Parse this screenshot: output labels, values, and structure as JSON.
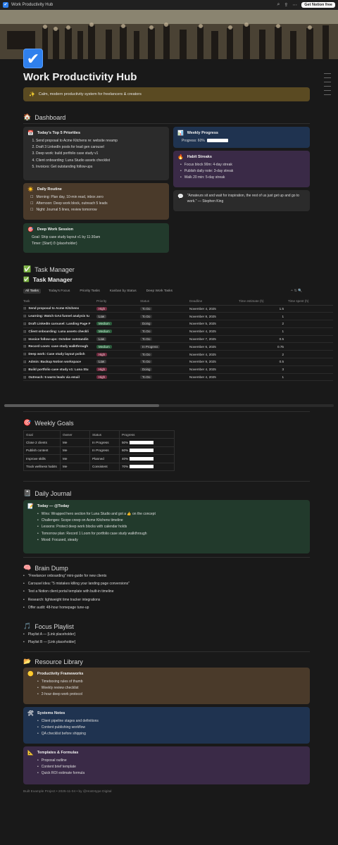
{
  "topbar": {
    "title": "Work Productivity Hub",
    "button": "Get Notion free",
    "icons": [
      "search-icon",
      "share-icon",
      "more-icon"
    ]
  },
  "page": {
    "icon": "✔",
    "title": "Work Productivity Hub",
    "banner": "Calm, modern productivity system for freelancers & creators",
    "banner_emoji": "✨"
  },
  "dashboard": {
    "heading": "Dashboard",
    "heading_emoji": "🏠",
    "priorities": {
      "title": "Today's Top 5 Priorities",
      "emoji": "📅",
      "items": [
        "Send proposal to Acme Kitchens re: website revamp",
        "Draft 3 LinkedIn posts for lead gen carousel",
        "Deep work: build portfolio case study v1",
        "Client onboarding: Luna Studio assets checklist",
        "Invoices: Get outstanding follow-ups"
      ]
    },
    "routine": {
      "title": "Daily Routine",
      "emoji": "☀️",
      "items": [
        "Morning: Plan day, 10-min read, inbox zero",
        "Afternoon: Deep work block, outreach 5 leads",
        "Night: Journal 5 lines, review tomorrow"
      ]
    },
    "deepwork": {
      "title": "Deep Work Session",
      "emoji": "🎯",
      "goal": "Goal: Ship case study layout v1 by 11:30am",
      "timer": "Timer: [Start] ⏱ (placeholder)"
    },
    "weekly": {
      "title": "Weekly Progress",
      "emoji": "📊",
      "label": "Progress: 60%",
      "value": 0.6
    },
    "streaks": {
      "title": "Habit Streaks",
      "emoji": "🔥",
      "items": [
        "Focus block 90m: 4-day streak",
        "Publish daily note: 3-day streak",
        "Walk 20 min: 5-day streak"
      ]
    },
    "quote": {
      "emoji": "💬",
      "text": "\"Amateurs sit and wait for inspiration, the rest of us just get up and go to work.\" — Stephen King"
    }
  },
  "tasks": {
    "heading": "Task Manager",
    "heading_emoji": "✅",
    "db_title": "Task Manager",
    "db_emoji": "✅",
    "tabs": [
      "All Tasks",
      "Today's Focus",
      "Priority Tasks",
      "Kanban by Status",
      "Deep Work Tasks"
    ],
    "columns": [
      "Task",
      "Priority",
      "Status",
      "Deadline",
      "Time estimate (h)",
      "Time spent (h)"
    ],
    "rows": [
      {
        "task": "Send proposal to Acme Kitchens",
        "priority": "High",
        "pclass": "p-high",
        "status": "To Do",
        "deadline": "November 4, 2025",
        "est": "1.5"
      },
      {
        "task": "Learning: Watch GA4 funnel analysis tu",
        "priority": "Low",
        "pclass": "p-low",
        "status": "To Do",
        "deadline": "November 8, 2025",
        "est": "1"
      },
      {
        "task": "Draft LinkedIn carousel: Landing Page F",
        "priority": "Medium",
        "pclass": "p-med",
        "status": "Doing",
        "deadline": "November 5, 2025",
        "est": "2"
      },
      {
        "task": "Client onboarding: Luna assets checkli",
        "priority": "Medium",
        "pclass": "p-med",
        "status": "To Do",
        "deadline": "November 4, 2025",
        "est": "1"
      },
      {
        "task": "Invoice follow-ups: October outstandin",
        "priority": "Low",
        "pclass": "p-low",
        "status": "To Do",
        "deadline": "November 7, 2025",
        "est": "0.5"
      },
      {
        "task": "Record Loom: case study walkthrough",
        "priority": "Medium",
        "pclass": "p-med",
        "status": "In Progress",
        "deadline": "November 6, 2025",
        "est": "0.75"
      },
      {
        "task": "Deep work: Case study layout polish",
        "priority": "High",
        "pclass": "p-high",
        "status": "To Do",
        "deadline": "November 4, 2025",
        "est": "2"
      },
      {
        "task": "Admin: Backup Notion workspace",
        "priority": "Low",
        "pclass": "p-low",
        "status": "To Do",
        "deadline": "November 9, 2025",
        "est": "0.5"
      },
      {
        "task": "Build portfolio case study v1: Luna Stu",
        "priority": "High",
        "pclass": "p-high",
        "status": "Doing",
        "deadline": "November 4, 2025",
        "est": "3"
      },
      {
        "task": "Outreach: 5 warm leads via email",
        "priority": "High",
        "pclass": "p-high",
        "status": "To Do",
        "deadline": "November 4, 2025",
        "est": "1"
      }
    ]
  },
  "goals": {
    "heading": "Weekly Goals",
    "heading_emoji": "🎯",
    "columns": [
      "Goal",
      "Owner",
      "Status",
      "Progress"
    ],
    "rows": [
      {
        "goal": "Close 2 clients",
        "owner": "Me",
        "status": "In Progress",
        "progress": "50%",
        "value": 0.5
      },
      {
        "goal": "Publish content",
        "owner": "Me",
        "status": "In Progress",
        "progress": "60%",
        "value": 0.6
      },
      {
        "goal": "Improve skills",
        "owner": "Me",
        "status": "Planned",
        "progress": "40%",
        "value": 0.4
      },
      {
        "goal": "Track wellness habits",
        "owner": "Me",
        "status": "Consistent",
        "progress": "70%",
        "value": 0.7
      }
    ]
  },
  "journal": {
    "heading": "Daily Journal",
    "heading_emoji": "📓",
    "title": "Today — @Today",
    "emoji": "📝",
    "items": [
      "Wins: Wrapped hero section for Luna Studio and got a 👍 on the concept",
      "Challenges: Scope creep on Acme Kitchens timeline",
      "Lessons: Protect deep work blocks with calendar holds",
      "Tomorrow plan: Record 1 Loom for portfolio case study walkthrough",
      "Mood: Focused, steady"
    ]
  },
  "braindump": {
    "heading": "Brain Dump",
    "heading_emoji": "🧠",
    "items": [
      "\"Freelancer onboarding\" mini-guide for new clients",
      "Carousel idea: \"5 mistakes killing your landing page conversions\"",
      "Test a Notion client portal template with built-in timeline",
      "Research: lightweight time tracker integrations",
      "Offer audit: 48-hour homepage tune-up"
    ]
  },
  "playlist": {
    "heading": "Focus Playlist",
    "heading_emoji": "🎵",
    "items": [
      "Playlist A — [Link placeholder]",
      "Playlist B — [Link placeholder]"
    ]
  },
  "resources": {
    "heading": "Resource Library",
    "heading_emoji": "📂",
    "frameworks": {
      "title": "Productivity Frameworks",
      "emoji": "🟡",
      "items": [
        "Timeboxing rules of thumb",
        "Weekly review checklist",
        "2-hour deep work protocol"
      ]
    },
    "systems": {
      "title": "Systems Notes",
      "emoji": "🛠",
      "items": [
        "Client pipeline stages and definitions",
        "Content publishing workflow",
        "QA checklist before shipping"
      ]
    },
    "templates": {
      "title": "Templates & Formulas",
      "emoji": "📐",
      "items": [
        "Proposal outline",
        "Content brief template",
        "Quick ROI estimate formula"
      ]
    }
  },
  "footer": "Built Example Project • 2025-11-04 • by @HostHype Digital"
}
